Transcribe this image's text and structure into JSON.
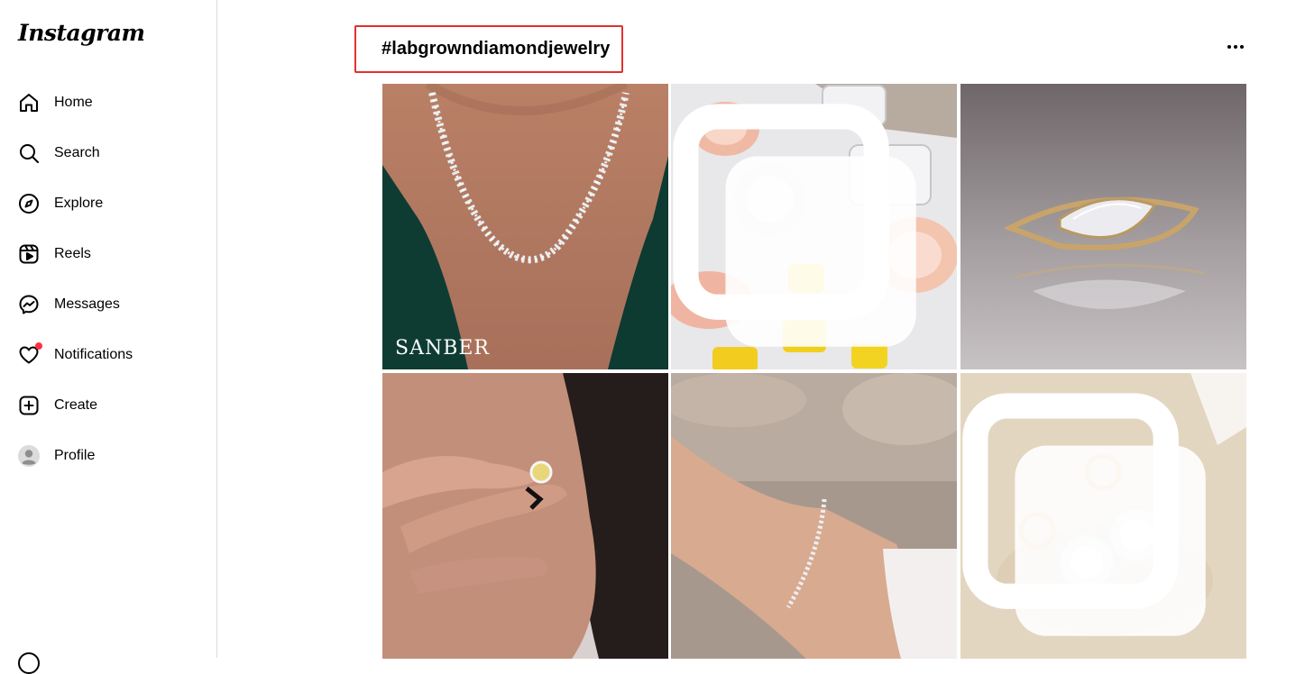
{
  "app": {
    "logo": "Instagram"
  },
  "sidebar": {
    "items": [
      {
        "label": "Home",
        "icon": "home-icon"
      },
      {
        "label": "Search",
        "icon": "search-icon"
      },
      {
        "label": "Explore",
        "icon": "compass-icon"
      },
      {
        "label": "Reels",
        "icon": "reels-icon"
      },
      {
        "label": "Messages",
        "icon": "messenger-icon"
      },
      {
        "label": "Notifications",
        "icon": "heart-icon",
        "badge": "red-dot"
      },
      {
        "label": "Create",
        "icon": "plus-square-icon"
      },
      {
        "label": "Profile",
        "icon": "avatar-icon"
      }
    ]
  },
  "main": {
    "hashtag": "#labgrowndiamondjewelry",
    "highlight_color": "#e0322d",
    "posts": [
      {
        "subject": "diamond tennis necklace on model in green dress",
        "multi": false,
        "watermark": "SANBER"
      },
      {
        "subject": "loose pink, white and yellow diamonds",
        "multi": true
      },
      {
        "subject": "marquise diamond gold ring with reflection",
        "multi": false
      },
      {
        "subject": "hand wearing yellow diamond flower ring",
        "multi": false
      },
      {
        "subject": "wrist with diamond tennis bracelet",
        "multi": false
      },
      {
        "subject": "gold hoop earrings with round diamonds",
        "multi": true
      }
    ]
  }
}
